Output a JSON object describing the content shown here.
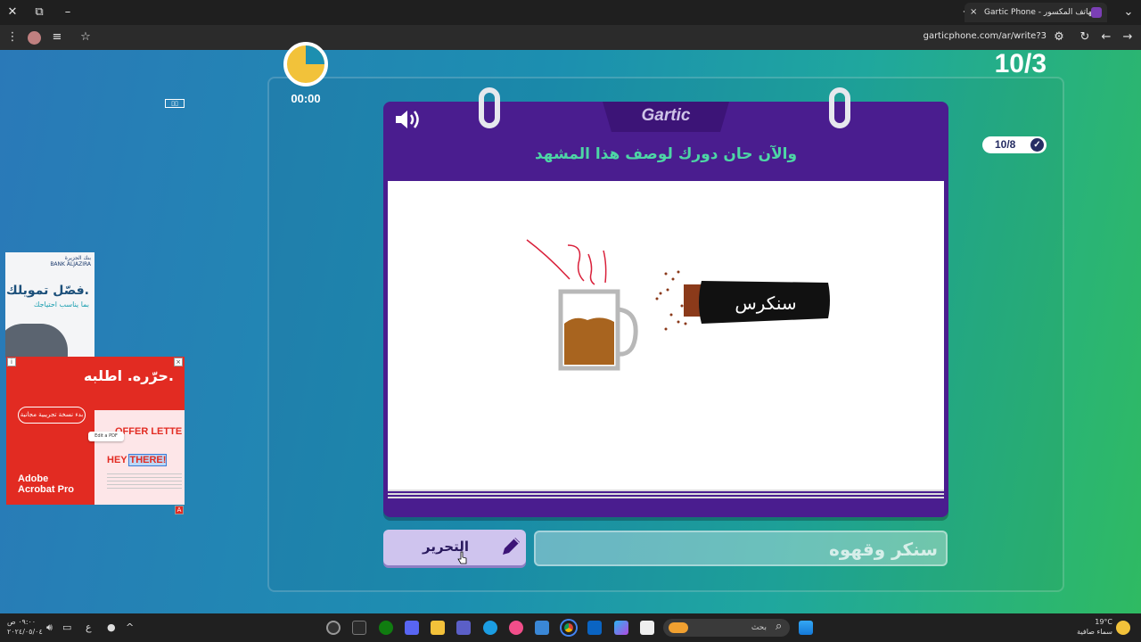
{
  "browser": {
    "tab_title": "Gartic Phone - الهاتف المكسور",
    "tab_close": "×",
    "new_tab": "+",
    "window_close": "✕",
    "window_max": "⧉",
    "window_min": "–",
    "tab_search": "⌄",
    "url": "garticphone.com/ar/write?3",
    "nav_back": "←",
    "nav_forward": "→",
    "reload": "↻",
    "menu": "⋮",
    "bookmark": "☆"
  },
  "game": {
    "logo": "Gartic",
    "timer": "00:00",
    "round": "10/3",
    "done_count": "10/8",
    "done_check": "✓",
    "title": "والآن حان دورك لوصف هذا المشهد",
    "drawing_label": "سنكرس",
    "edit_button": "التحرير",
    "answer_value": "سنكر وقهوه"
  },
  "ads": {
    "bank_name": "بنك الجزيرة",
    "bank_name_en": "BANK ALJAZIRA",
    "bank_headline": "فصّل تمويلك.",
    "bank_sub": "بما يناسب احتياجك",
    "adobe_headline": "حرّره. اطلبه.",
    "adobe_trial": "بدء نسخة تجريبية مجانية",
    "adobe_brand_1": "Adobe",
    "adobe_brand_2": "Acrobat Pro",
    "adobe_offer": "OFFER LETTE",
    "adobe_hey": "HEY ",
    "adobe_there": "THERE!",
    "adobe_edit_pdf": "Edit a PDF",
    "ad_close": "×",
    "ad_badge": "A"
  },
  "taskbar": {
    "time": "٠٩:٠٠ ص",
    "date": "٢٠٢٤/٠٥/٠٤",
    "lang": "ع",
    "search_placeholder": "بحث",
    "temperature": "19°C",
    "weather": "سماء صافية",
    "search_icon": "⌕",
    "chevron": "^"
  },
  "colors": {
    "card": "#4a1d8f",
    "title": "#4dd6a5",
    "button": "#cfc4ee"
  }
}
